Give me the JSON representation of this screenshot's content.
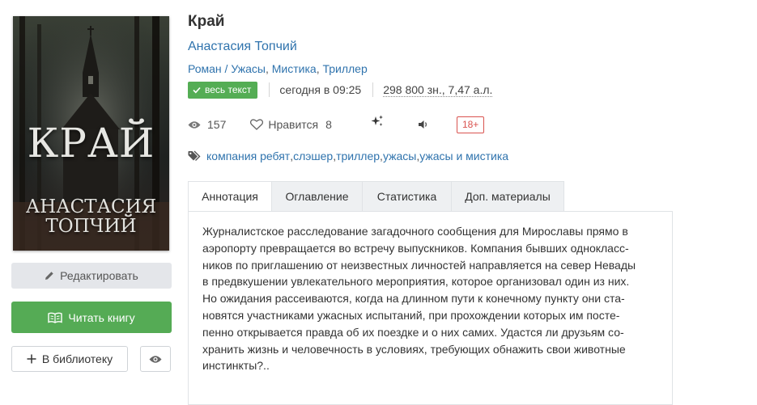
{
  "cover": {
    "title": "КРАЙ",
    "author_line1": "АНАСТАСИЯ",
    "author_line2": "ТОПЧИЙ"
  },
  "actions": {
    "edit_label": "Редактировать",
    "read_label": "Читать книгу",
    "library_label": "В библиотеку"
  },
  "book": {
    "title": "Край",
    "author": "Анастасия Топчий",
    "genres": [
      "Роман / Ужасы",
      "Мистика",
      "Триллер"
    ]
  },
  "meta": {
    "status_badge": "весь текст",
    "updated": "сегодня в 09:25",
    "size": "298 800 зн., 7,47 а.л."
  },
  "stats": {
    "views": "157",
    "likes_label": "Нравится",
    "likes_count": "8",
    "age_rating": "18+"
  },
  "tags": [
    "компания ребят",
    "слэшер",
    "триллер",
    "ужасы",
    "ужасы и мистика"
  ],
  "tabs": [
    "Аннотация",
    "Оглавление",
    "Статистика",
    "Доп. материалы"
  ],
  "annotation_lines": [
    "Журналистское расследование загадочного сообщения для Мирославы прямо в",
    "аэропорту превращается во встречу выпускников. Компания бывших однокласс-",
    "ников по приглашению от неизвестных личностей направляется на север Невады",
    "в предвкушении увлекательного мероприятия, которое организовал один из них.",
    "Но ожидания рассеиваются, когда на длинном пути к конечному пункту они ста-",
    "новятся участниками ужасных испытаний, при прохождении которых им посте-",
    "пенно открывается правда об их поездке и о них самих. Удастся ли друзьям со-",
    "хранить жизнь и человечность в условиях, требующих обнажить свои животные",
    "инстинкты?.."
  ],
  "colors": {
    "link": "#2f73ad",
    "green": "#55ab55",
    "age_badge": "#d9534f"
  }
}
